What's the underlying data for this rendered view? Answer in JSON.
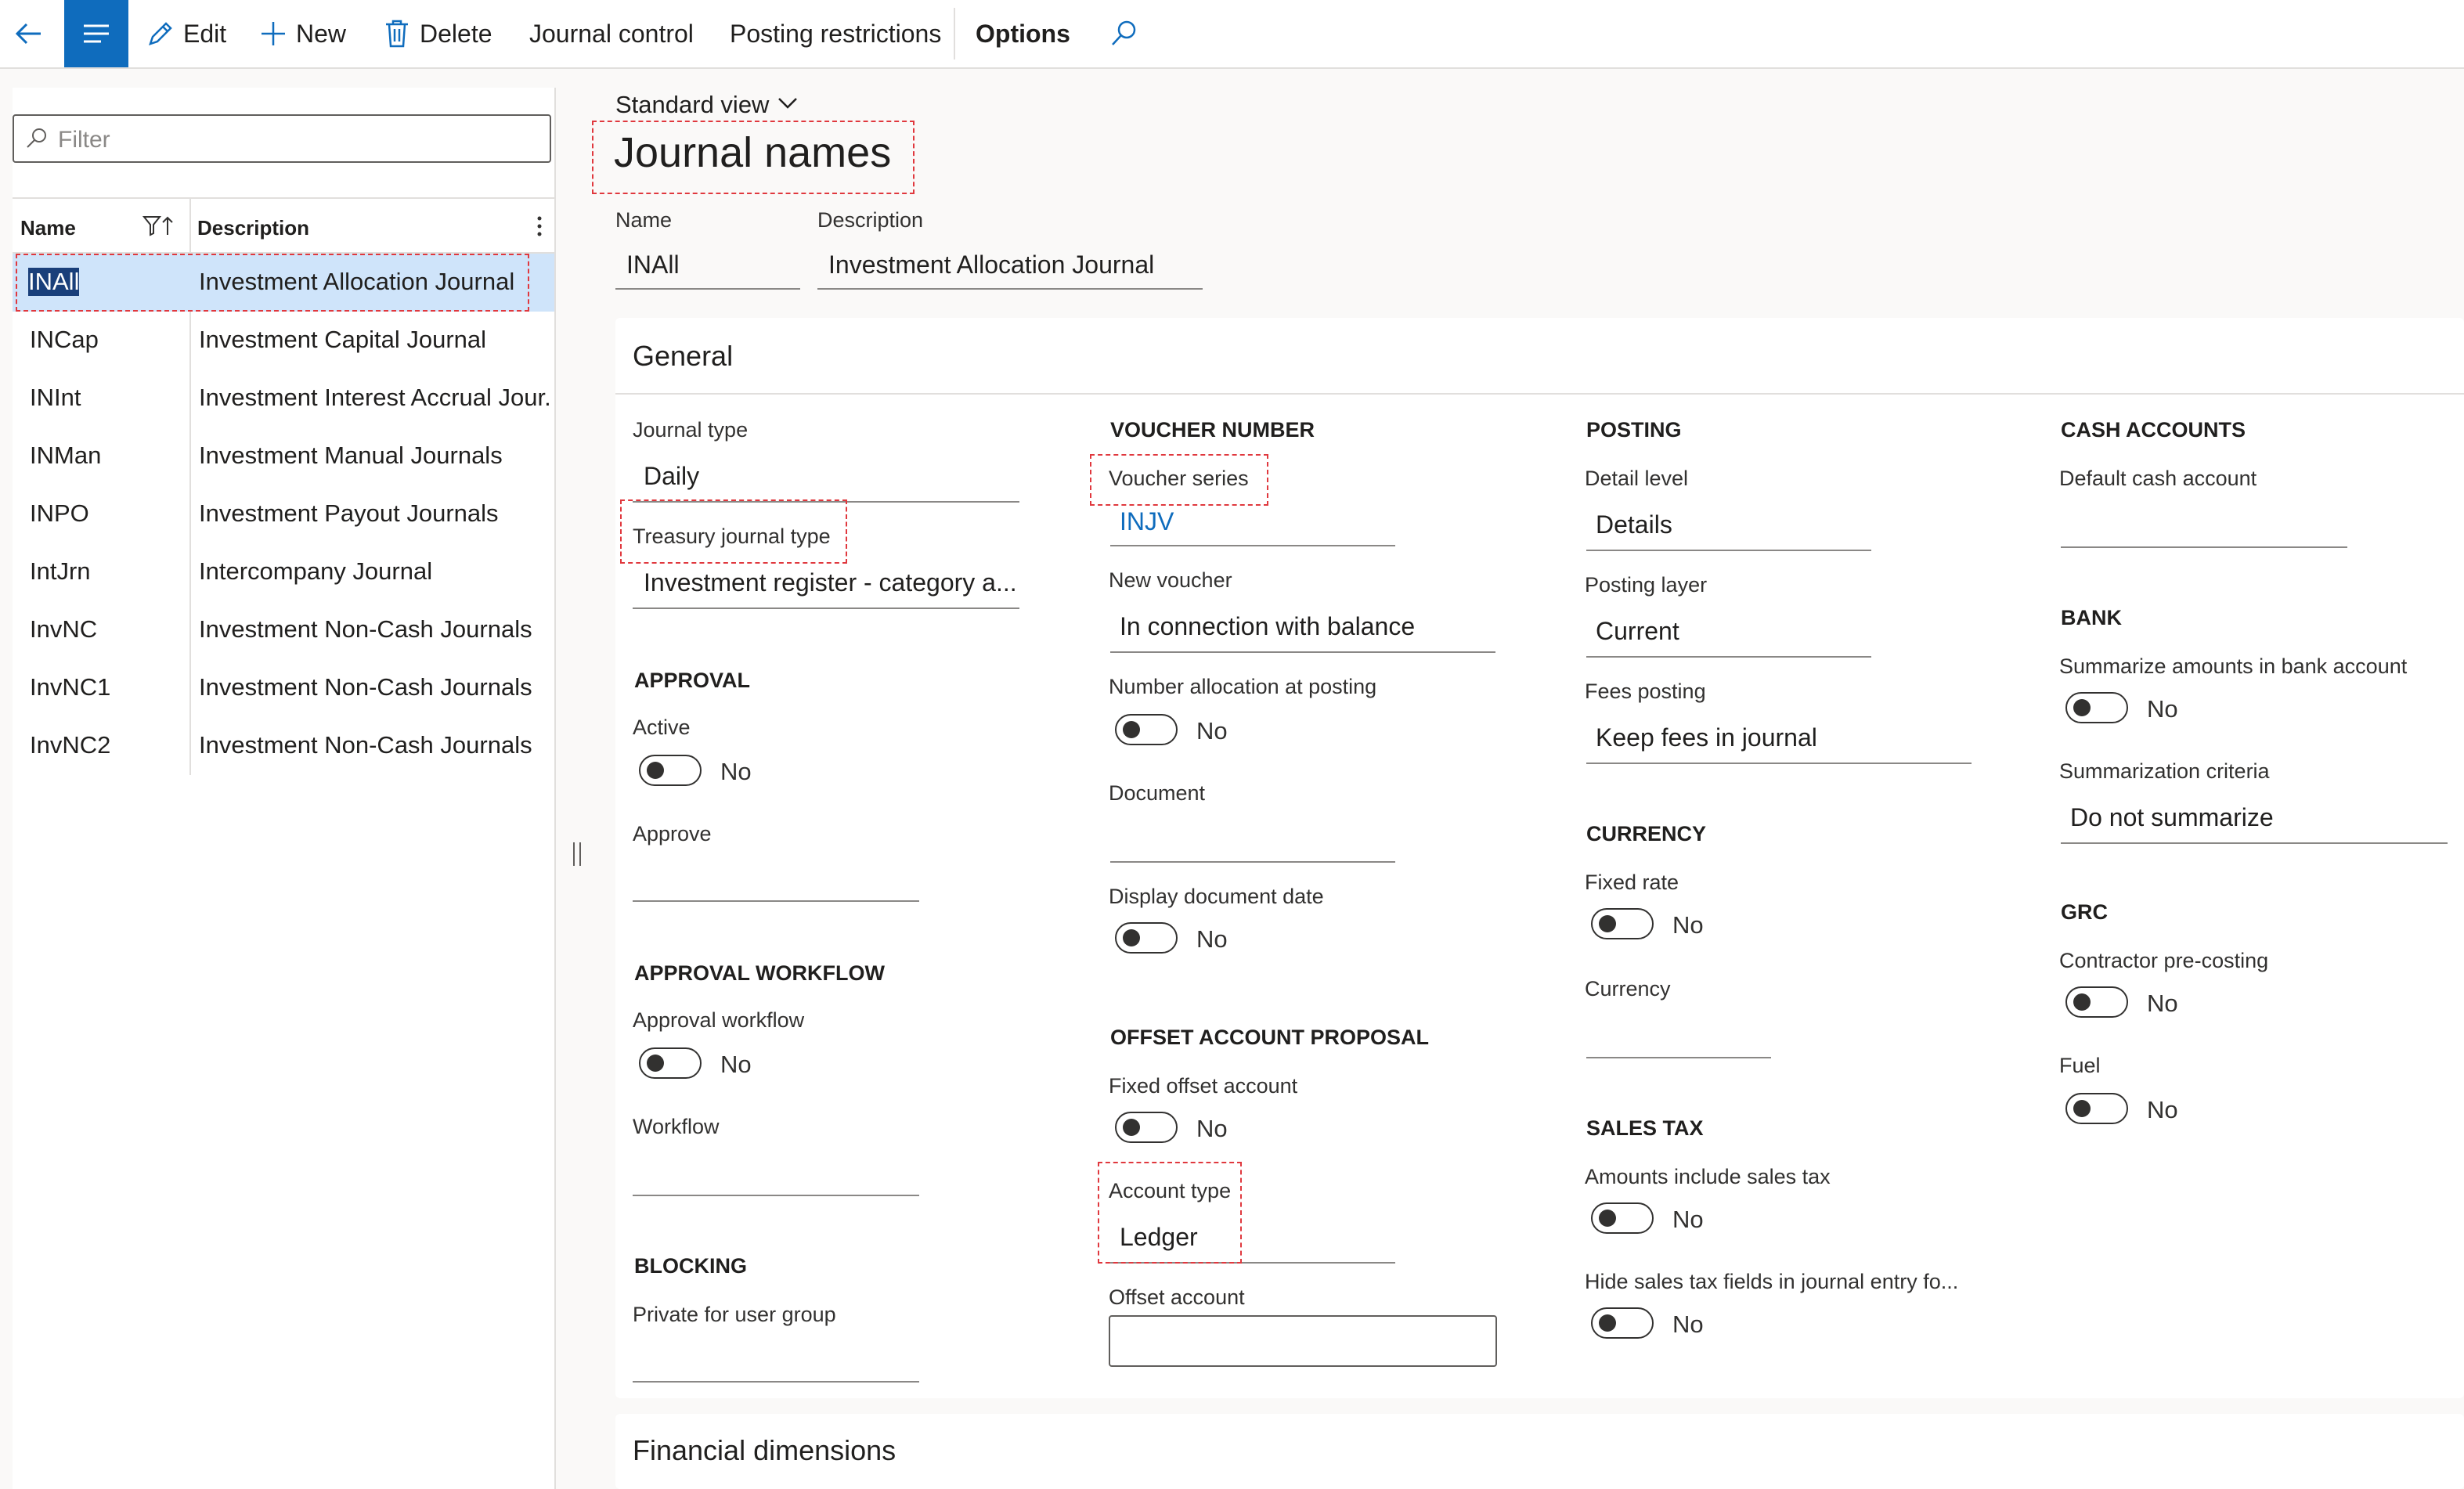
{
  "toolbar": {
    "edit": "Edit",
    "new": "New",
    "delete": "Delete",
    "journal_control": "Journal control",
    "posting_restrictions": "Posting restrictions",
    "options": "Options"
  },
  "filter": {
    "placeholder": "Filter"
  },
  "grid": {
    "col_name": "Name",
    "col_description": "Description",
    "rows": [
      {
        "name": "INAll",
        "description": "Investment Allocation Journal"
      },
      {
        "name": "INCap",
        "description": "Investment Capital Journal"
      },
      {
        "name": "INInt",
        "description": "Investment Interest Accrual Jour..."
      },
      {
        "name": "INMan",
        "description": "Investment Manual Journals"
      },
      {
        "name": "INPO",
        "description": "Investment Payout Journals"
      },
      {
        "name": "IntJrn",
        "description": "Intercompany Journal"
      },
      {
        "name": "InvNC",
        "description": "Investment Non-Cash Journals"
      },
      {
        "name": "InvNC1",
        "description": "Investment Non-Cash Journals"
      },
      {
        "name": "InvNC2",
        "description": "Investment Non-Cash Journals"
      }
    ]
  },
  "header": {
    "view": "Standard view",
    "title": "Journal names",
    "name_label": "Name",
    "name_value": "INAll",
    "desc_label": "Description",
    "desc_value": "Investment Allocation Journal"
  },
  "general": {
    "title": "General",
    "journal_type_label": "Journal type",
    "journal_type_value": "Daily",
    "treasury_label": "Treasury journal type",
    "treasury_value": "Investment register - category a...",
    "approval_title": "APPROVAL",
    "active_label": "Active",
    "active_value": "No",
    "approve_label": "Approve",
    "approval_workflow_title": "APPROVAL WORKFLOW",
    "approval_workflow_label": "Approval workflow",
    "approval_workflow_value": "No",
    "workflow_label": "Workflow",
    "blocking_title": "BLOCKING",
    "private_label": "Private for user group",
    "voucher_title": "VOUCHER NUMBER",
    "voucher_series_label": "Voucher series",
    "voucher_series_value": "INJV",
    "new_voucher_label": "New voucher",
    "new_voucher_value": "In connection with balance",
    "number_alloc_label": "Number allocation at posting",
    "number_alloc_value": "No",
    "document_label": "Document",
    "display_doc_date_label": "Display document date",
    "display_doc_date_value": "No",
    "offset_title": "OFFSET ACCOUNT PROPOSAL",
    "fixed_offset_label": "Fixed offset account",
    "fixed_offset_value": "No",
    "account_type_label": "Account type",
    "account_type_value": "Ledger",
    "offset_account_label": "Offset account",
    "posting_title": "POSTING",
    "detail_level_label": "Detail level",
    "detail_level_value": "Details",
    "posting_layer_label": "Posting layer",
    "posting_layer_value": "Current",
    "fees_posting_label": "Fees posting",
    "fees_posting_value": "Keep fees in journal",
    "currency_title": "CURRENCY",
    "fixed_rate_label": "Fixed rate",
    "fixed_rate_value": "No",
    "currency_label": "Currency",
    "sales_tax_title": "SALES TAX",
    "amounts_incl_label": "Amounts include sales tax",
    "amounts_incl_value": "No",
    "hide_sales_label": "Hide sales tax fields in journal entry fo...",
    "hide_sales_value": "No",
    "cash_title": "CASH ACCOUNTS",
    "default_cash_label": "Default cash account",
    "bank_title": "BANK",
    "summarize_label": "Summarize amounts in bank account",
    "summarize_value": "No",
    "summ_criteria_label": "Summarization criteria",
    "summ_criteria_value": "Do not summarize",
    "grc_title": "GRC",
    "contractor_label": "Contractor pre-costing",
    "contractor_value": "No",
    "fuel_label": "Fuel",
    "fuel_value": "No"
  },
  "financial": {
    "title": "Financial dimensions"
  },
  "colors": {
    "accent": "#0f6cbd",
    "highlight": "#e0383e",
    "selected_row": "#cfe4fa"
  }
}
